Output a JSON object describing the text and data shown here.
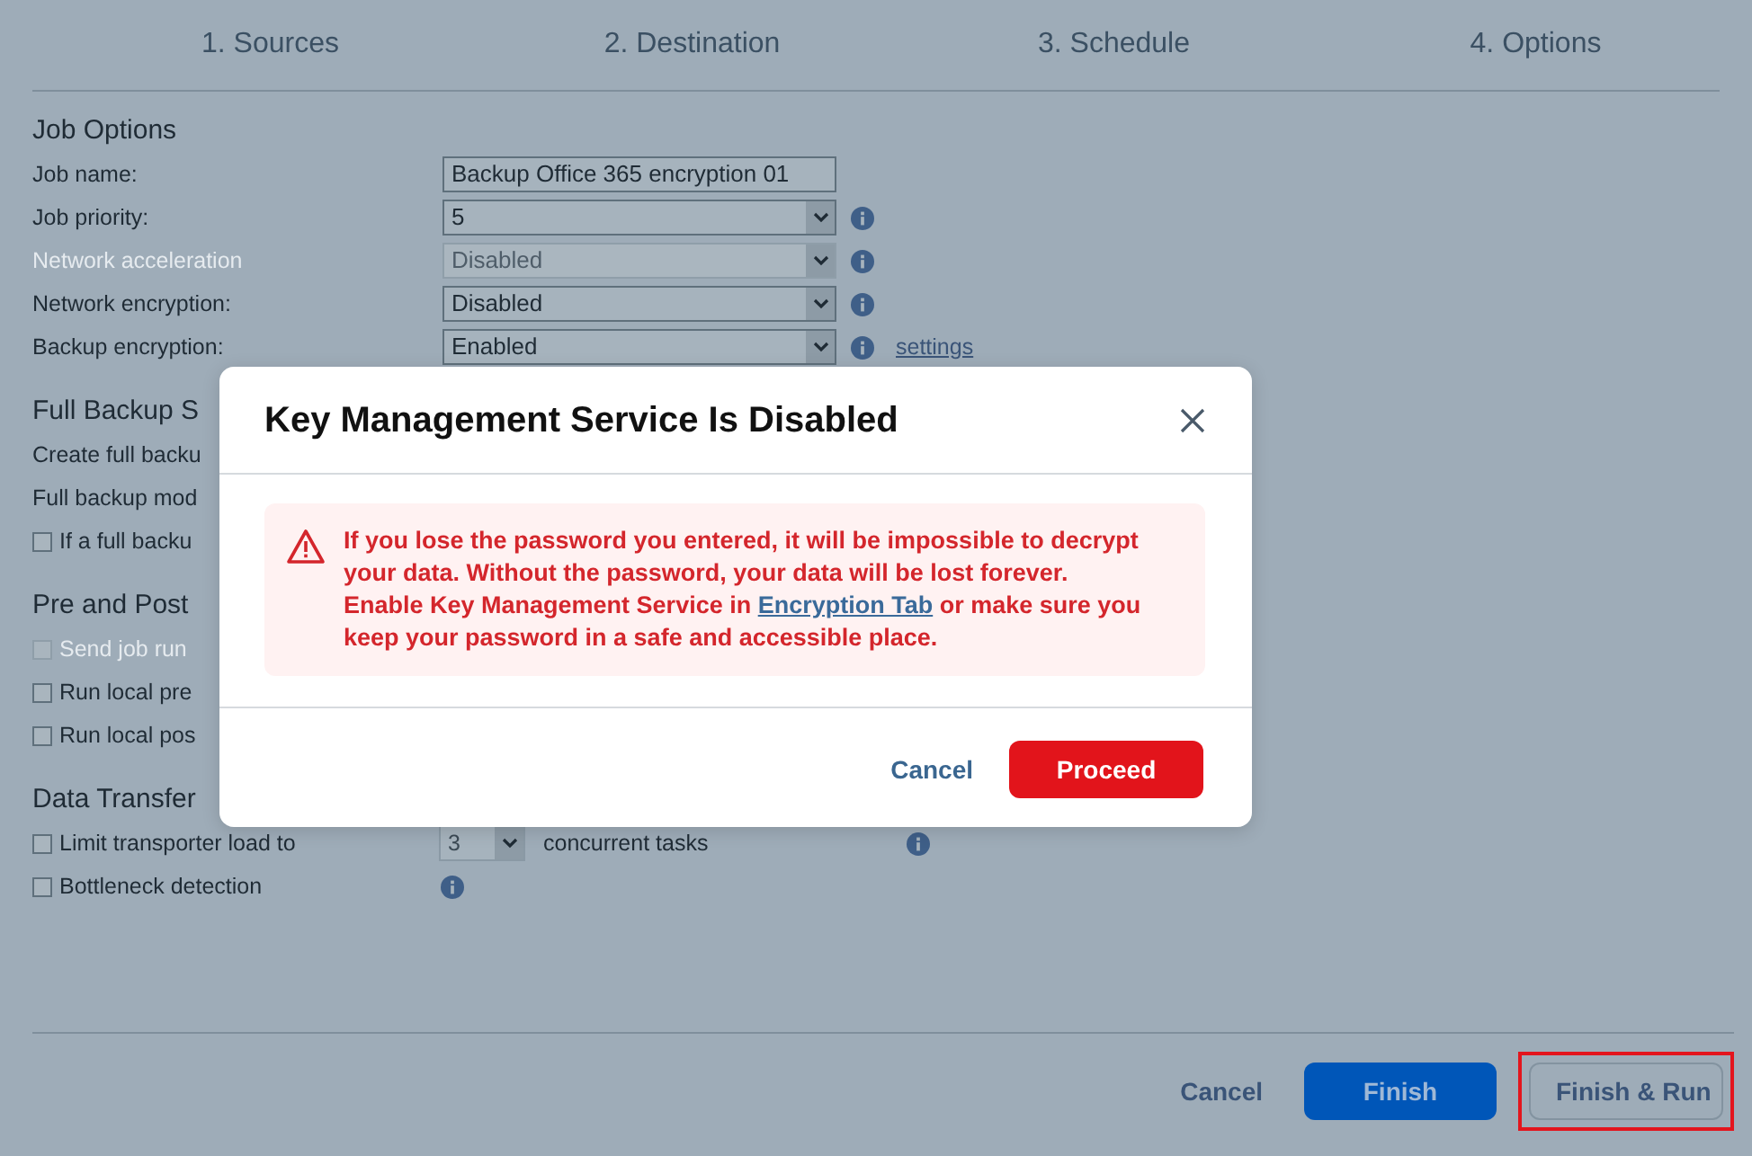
{
  "steps": [
    {
      "label": "1. Sources"
    },
    {
      "label": "2. Destination"
    },
    {
      "label": "3. Schedule"
    },
    {
      "label": "4. Options"
    }
  ],
  "sections": [
    {
      "title": "Job Options",
      "rows": [
        {
          "kind": "text",
          "label": "Job name:",
          "value": "Backup Office 365 encryption 01",
          "disabled": false
        },
        {
          "kind": "select",
          "label": "Job priority:",
          "value": "5",
          "disabled": false,
          "info": true
        },
        {
          "kind": "select",
          "label": "Network acceleration",
          "value": "Disabled",
          "disabled": true,
          "info": true
        },
        {
          "kind": "select",
          "label": "Network encryption:",
          "value": "Disabled",
          "disabled": false,
          "info": true
        },
        {
          "kind": "select",
          "label": "Backup encryption:",
          "value": "Enabled",
          "disabled": false,
          "info": true,
          "link": "settings"
        }
      ]
    },
    {
      "title": "Full Backup S",
      "rows": [
        {
          "kind": "label",
          "label": "Create full backu"
        },
        {
          "kind": "label",
          "label": "Full backup mod"
        },
        {
          "kind": "checkbox",
          "label": "If a full backu",
          "checked": false,
          "disabled": false
        }
      ]
    },
    {
      "title": "Pre and Post",
      "rows": [
        {
          "kind": "checkbox",
          "label": "Send job run",
          "checked": false,
          "disabled": true
        },
        {
          "kind": "checkbox",
          "label": "Run local pre",
          "checked": false,
          "disabled": false
        },
        {
          "kind": "checkbox",
          "label": "Run local pos",
          "checked": false,
          "disabled": false
        }
      ]
    },
    {
      "title": "Data Transfer",
      "rows": [
        {
          "kind": "limit",
          "label": "Limit transporter load to",
          "checked": false,
          "disabled": false,
          "value": "3",
          "suffix": "concurrent tasks",
          "info": true
        },
        {
          "kind": "checkbox",
          "label": "Bottleneck detection",
          "checked": false,
          "disabled": false,
          "info": true
        }
      ]
    }
  ],
  "footer": {
    "buttons": [
      {
        "kind": "link",
        "label": "Cancel",
        "highlighted": false
      },
      {
        "kind": "primary",
        "label": "Finish",
        "highlighted": false
      },
      {
        "kind": "outline",
        "label": "Finish & Run",
        "highlighted": true
      }
    ]
  },
  "dialog": {
    "title": "Key Management Service Is Disabled",
    "paragraphs": [
      {
        "parts": [
          {
            "kind": "text",
            "text": "If you lose the password you entered, it will be impossible to decrypt your data. Without the password, your data will be lost forever."
          }
        ]
      },
      {
        "parts": [
          {
            "kind": "text",
            "text": "Enable Key Management Service in "
          },
          {
            "kind": "link",
            "text": "Encryption Tab"
          },
          {
            "kind": "text",
            "text": " or make sure you keep your password in a safe and accessible place."
          }
        ]
      }
    ],
    "buttons": [
      {
        "kind": "link",
        "label": "Cancel"
      },
      {
        "kind": "danger",
        "label": "Proceed"
      }
    ]
  }
}
